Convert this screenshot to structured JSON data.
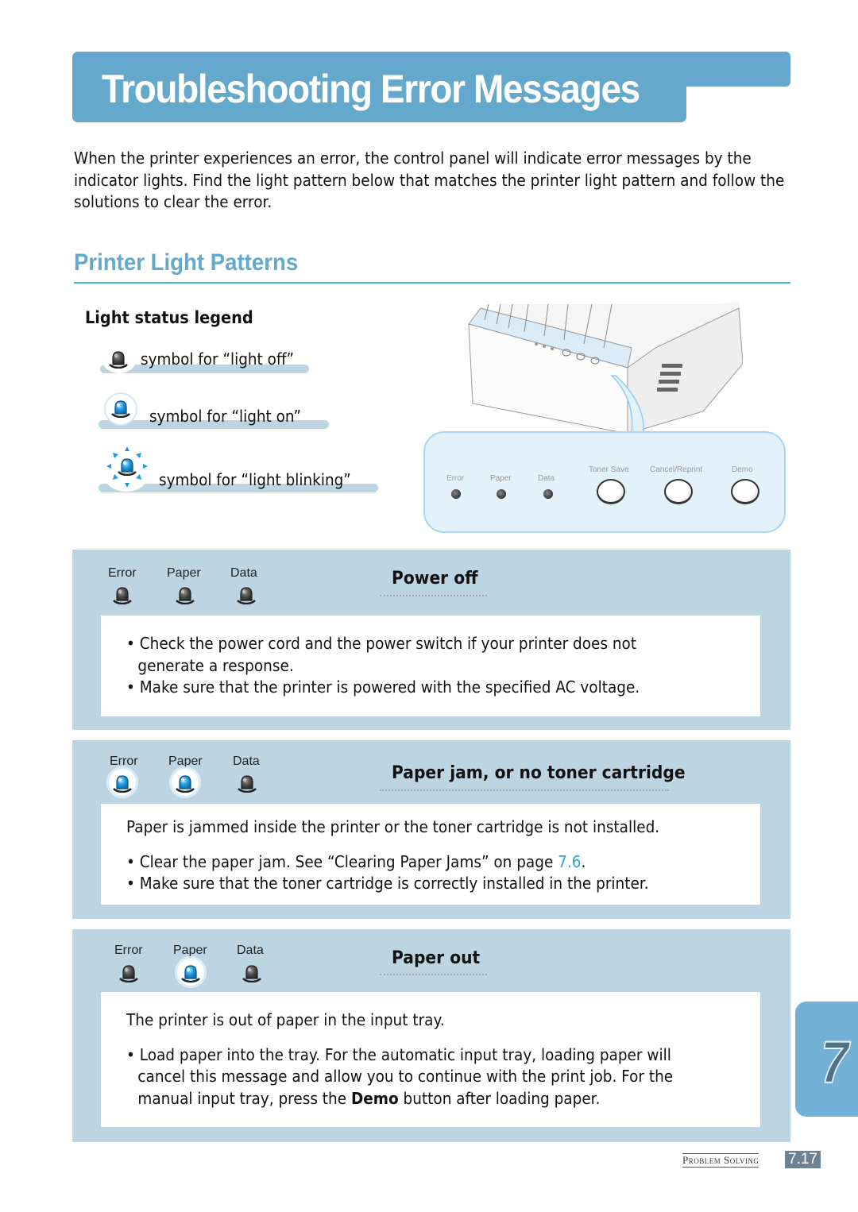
{
  "page": {
    "title": "Troubleshooting Error Messages",
    "intro": "When the printer experiences an error, the control panel will indicate error messages by the indicator lights. Find the light pattern below that matches the printer light pattern and follow the solutions to clear the error.",
    "section_title": "Printer Light Patterns"
  },
  "legend": {
    "title": "Light status legend",
    "items": [
      {
        "state": "off",
        "icon": "light-off-icon",
        "label": "symbol for “light off”"
      },
      {
        "state": "on",
        "icon": "light-on-icon",
        "label": "symbol for “light on”"
      },
      {
        "state": "blinking",
        "icon": "light-blinking-icon",
        "label": "symbol for “light blinking”"
      }
    ]
  },
  "control_panel": {
    "lights": [
      "Error",
      "Paper",
      "Data"
    ],
    "buttons": [
      "Toner Save",
      "Cancel/Reprint",
      "Demo"
    ]
  },
  "errors": [
    {
      "lights": [
        {
          "name": "Error",
          "state": "off"
        },
        {
          "name": "Paper",
          "state": "off"
        },
        {
          "name": "Data",
          "state": "off"
        }
      ],
      "heading": "Power off",
      "description": "",
      "bullets": [
        "Check the power cord and the power switch if your printer does not generate a response.",
        "Make sure that the printer is powered with the specified AC voltage."
      ]
    },
    {
      "lights": [
        {
          "name": "Error",
          "state": "on"
        },
        {
          "name": "Paper",
          "state": "on"
        },
        {
          "name": "Data",
          "state": "off"
        }
      ],
      "heading": "Paper jam, or no toner cartridge",
      "description": "Paper is jammed inside the printer or the toner cartridge is not installed.",
      "bullets": [
        "Clear the paper jam. See “Clearing Paper Jams” on page ",
        "Make sure that the toner cartridge is correctly installed in the printer."
      ],
      "link_text": "7.6",
      "link_suffix": "."
    },
    {
      "lights": [
        {
          "name": "Error",
          "state": "off"
        },
        {
          "name": "Paper",
          "state": "on"
        },
        {
          "name": "Data",
          "state": "off"
        }
      ],
      "heading": "Paper out",
      "description": "The printer is out of paper in the input tray.",
      "bullets_parts": {
        "before": "Load paper into the tray. For the automatic input tray, loading paper will cancel this message and allow you to continue with the print job. For the manual input tray, press the ",
        "bold": "Demo",
        "after": " button after loading paper."
      }
    }
  ],
  "chapter_tab": "7",
  "footer": {
    "section": "Problem Solving",
    "page": "7.17"
  },
  "colors": {
    "accent": "#64a8cb",
    "box_bg": "#bdd5e3",
    "link": "#2aa2dc",
    "light_on": "#1e9be0",
    "light_off": "#444444"
  }
}
